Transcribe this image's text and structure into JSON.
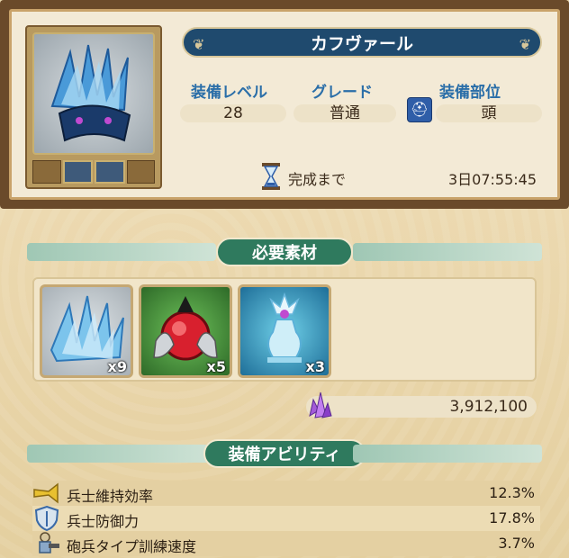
{
  "equipment": {
    "name": "カフヴァール",
    "level_label": "装備レベル",
    "level": "28",
    "grade_label": "グレード",
    "grade": "普通",
    "slot_label": "装備部位",
    "slot": "頭",
    "slot_icon": "helmet-icon"
  },
  "timer": {
    "label": "完成まで",
    "value": "3日07:55:45",
    "icon": "hourglass-icon"
  },
  "materials": {
    "title": "必要素材",
    "items": [
      {
        "icon": "ice-shard-icon",
        "count": "x9"
      },
      {
        "icon": "red-orb-dragon-icon",
        "count": "x5"
      },
      {
        "icon": "crystal-vase-icon",
        "count": "x3"
      }
    ],
    "cost_icon": "purple-crystal-icon",
    "cost": "3,912,100"
  },
  "abilities": {
    "title": "装備アビリティ",
    "items": [
      {
        "icon": "trumpet-icon",
        "name": "兵士維持効率",
        "value": "12.3%"
      },
      {
        "icon": "shield-icon",
        "name": "兵士防御力",
        "value": "17.8%"
      },
      {
        "icon": "cannon-soldier-icon",
        "name": "砲兵タイプ訓練速度",
        "value": "3.7%"
      }
    ]
  },
  "colors": {
    "banner": "#1f4a6e",
    "section_pill": "#2f7a5e",
    "label_blue": "#2a6ea8"
  }
}
